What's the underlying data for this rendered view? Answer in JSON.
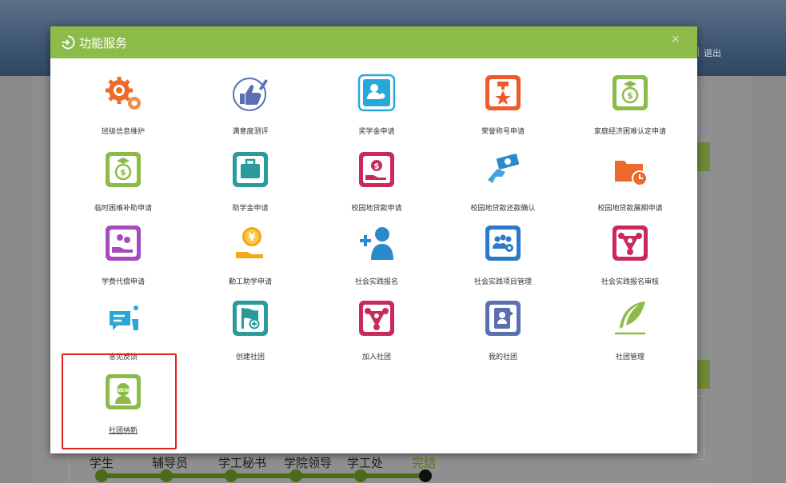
{
  "header": {
    "logout_label": "退出"
  },
  "modal": {
    "title": "功能服务",
    "close_label": "×"
  },
  "services": [
    {
      "label": "班级信息维护",
      "icon": "gears-icon",
      "color": "#ee6a2a"
    },
    {
      "label": "满意度测评",
      "icon": "thumbs-up-icon",
      "color": "#5b6fb3"
    },
    {
      "label": "奖学金申请",
      "icon": "scholarship-icon",
      "color": "#29a8d8"
    },
    {
      "label": "荣誉称号申请",
      "icon": "honor-medal-icon",
      "color": "#ee5a2a"
    },
    {
      "label": "家庭经济困难认定申请",
      "icon": "money-bag-icon",
      "color": "#8cbb4a"
    },
    {
      "label": "临时困难补助申请",
      "icon": "money-bag-icon",
      "color": "#8cbb4a"
    },
    {
      "label": "助学金申请",
      "icon": "briefcase-icon",
      "color": "#2a9a9a"
    },
    {
      "label": "校园地贷款申请",
      "icon": "coin-hand-icon",
      "color": "#c92a5a"
    },
    {
      "label": "校园地贷款还款确认",
      "icon": "cash-hand-icon",
      "color": "#2a8acb"
    },
    {
      "label": "校园地贷款展期申请",
      "icon": "folder-clock-icon",
      "color": "#ee6a2a"
    },
    {
      "label": "学费代偿申请",
      "icon": "coins-hand-icon",
      "color": "#a64ac0"
    },
    {
      "label": "勤工助学申请",
      "icon": "yuan-coin-hand-icon",
      "color": "#f2a81a"
    },
    {
      "label": "社会实践报名",
      "icon": "add-user-icon",
      "color": "#2a8acb"
    },
    {
      "label": "社会实践项目管理",
      "icon": "group-gear-icon",
      "color": "#2a7acb"
    },
    {
      "label": "社会实践报名审核",
      "icon": "network-icon",
      "color": "#c92a5a"
    },
    {
      "label": "意见反馈",
      "icon": "chat-bubble-icon",
      "color": "#29a8d8"
    },
    {
      "label": "创建社团",
      "icon": "flag-add-icon",
      "color": "#2a9a9a"
    },
    {
      "label": "加入社团",
      "icon": "network-icon",
      "color": "#c92a5a"
    },
    {
      "label": "我的社团",
      "icon": "id-card-icon",
      "color": "#5b6fb3"
    },
    {
      "label": "社团管理",
      "icon": "feather-icon",
      "color": "#8cbb4a"
    },
    {
      "label": "社团纳新",
      "icon": "new-member-icon",
      "color": "#8cbb4a"
    }
  ],
  "workflow": {
    "steps": [
      "学生",
      "辅导员",
      "学工秘书",
      "学院领导",
      "学工处",
      "完结"
    ]
  }
}
